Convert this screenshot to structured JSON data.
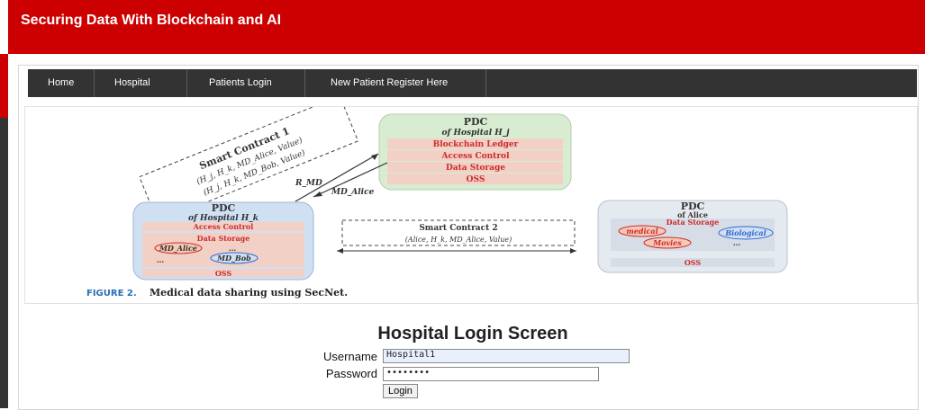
{
  "app": {
    "title": "Securing Data With Blockchain and AI"
  },
  "nav": {
    "items": [
      "Home",
      "Hospital",
      "Patients Login",
      "New Patient Register Here"
    ]
  },
  "figure": {
    "pdc_hj": {
      "title": "PDC",
      "subtitle": "of Hospital H_j",
      "rows": [
        "Blockchain Ledger",
        "Access Control",
        "Data Storage",
        "OSS"
      ]
    },
    "pdc_hk": {
      "title": "PDC",
      "subtitle": "of Hospital H_k",
      "rows": [
        "Access Control",
        "Data Storage",
        "OSS"
      ],
      "items": [
        "MD_Alice",
        "MD_Bob",
        "...",
        "..."
      ]
    },
    "pdc_alice": {
      "title": "PDC",
      "subtitle": "of Alice",
      "rows": [
        "Data Storage",
        "OSS"
      ],
      "items": [
        "medical",
        "Biological",
        "Movies",
        "..."
      ]
    },
    "smart_contract_1": {
      "title": "Smart Contract 1",
      "line1": "(H_j, H_k, MD_Alice, Value)",
      "line2": "(H_j, H_k, MD_Bob, Value)"
    },
    "smart_contract_2": {
      "title": "Smart Contract 2",
      "line1": "(Alice, H_k, MD_Alice, Value)"
    },
    "arrow_labels": [
      "R_MD",
      "MD_Alice"
    ],
    "caption_label": "FIGURE 2.",
    "caption_text": "Medical data sharing using SecNet."
  },
  "login": {
    "heading": "Hospital Login Screen",
    "username_label": "Username",
    "username_value": "Hospital1",
    "password_label": "Password",
    "password_value": "••••••••",
    "button_label": "Login"
  },
  "colors": {
    "brand_red": "#cc0000",
    "nav_bg": "#333333",
    "pdc_hj_bg": "#d8ecd2",
    "pdc_blue_bg": "#cfe0f3",
    "figure_text_red": "#cc2b2b"
  }
}
